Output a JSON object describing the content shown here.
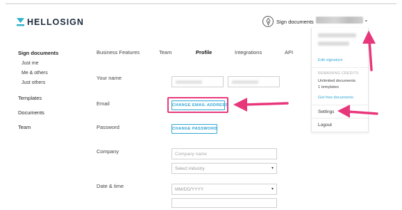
{
  "header": {
    "logo_text": "HELLOSIGN",
    "sign_documents_label": "Sign documents",
    "user_menu_icon": "chevron-down-icon"
  },
  "sidebar": {
    "items": [
      {
        "label": "Sign documents",
        "bold": true
      },
      {
        "label": "Just me"
      },
      {
        "label": "Me & others"
      },
      {
        "label": "Just others"
      },
      {
        "label": "Templates"
      },
      {
        "label": "Documents"
      },
      {
        "label": "Team"
      }
    ]
  },
  "tabs": [
    {
      "label": "Business Features"
    },
    {
      "label": "Team"
    },
    {
      "label": "Profile",
      "active": true
    },
    {
      "label": "Integrations"
    },
    {
      "label": "API"
    }
  ],
  "form": {
    "your_name_label": "Your name",
    "email_label": "Email",
    "change_email_button": "CHANGE EMAIL ADDRESS",
    "password_label": "Password",
    "change_password_button": "CHANGE PASSWORD",
    "company_label": "Company",
    "company_placeholder": "Company name",
    "industry_select": "Select industry",
    "date_time_label": "Date & time",
    "date_format_select": "MM/DD/YYYY"
  },
  "user_menu": {
    "edit_signature": "Edit signature",
    "remaining_credits_heading": "REMAINING CREDITS",
    "credit_documents": "Unlimited documents",
    "credit_templates": "1 templates",
    "get_free_documents": "Get free documents",
    "settings": "Settings",
    "logout": "Logout"
  },
  "colors": {
    "accent": "#2fa6d7",
    "annotation": "#e8367a",
    "logo": "#1c2c3c"
  }
}
